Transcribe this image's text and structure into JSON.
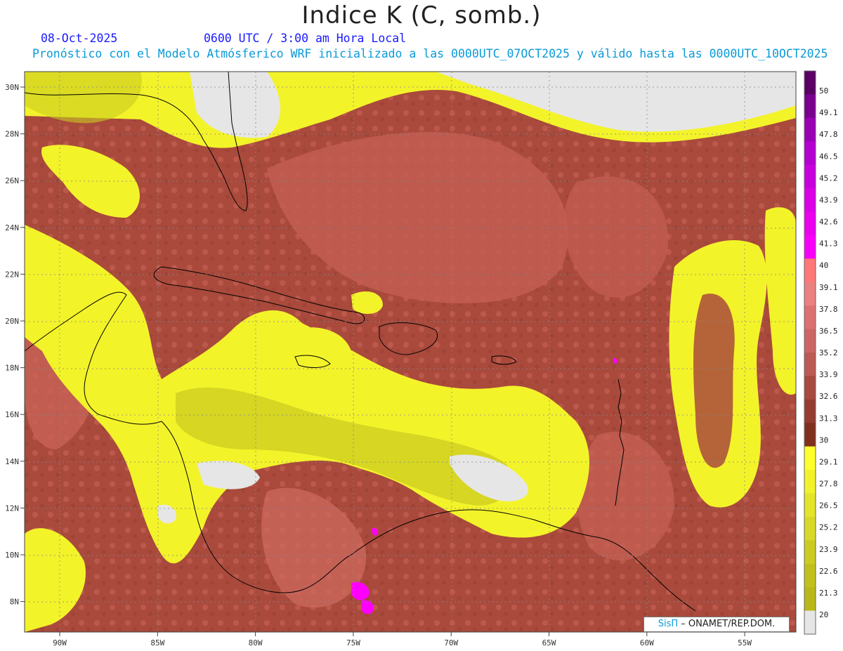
{
  "header": {
    "title": "Indice K (C, somb.)",
    "date": "08-Oct-2025",
    "time": "0600 UTC / 3:00 am Hora Local",
    "forecast": "Pronóstico con el Modelo Atmósferico WRF inicializado a las 0000UTC_07OCT2025 y válido hasta las  0000UTC_10OCT2025"
  },
  "axes": {
    "lon_labels": [
      "90W",
      "85W",
      "80W",
      "75W",
      "70W",
      "65W",
      "60W",
      "55W"
    ],
    "lat_labels": [
      "30N",
      "28N",
      "26N",
      "24N",
      "22N",
      "20N",
      "18N",
      "16N",
      "14N",
      "12N",
      "10N",
      "8N"
    ]
  },
  "colorbar": {
    "labels": [
      "50",
      "49.1",
      "47.8",
      "46.5",
      "45.2",
      "43.9",
      "42.6",
      "41.3",
      "40",
      "39.1",
      "37.8",
      "36.5",
      "35.2",
      "33.9",
      "32.6",
      "31.3",
      "30",
      "29.1",
      "27.8",
      "26.5",
      "25.2",
      "23.9",
      "22.6",
      "21.3",
      "20"
    ],
    "colors": [
      "#5a0064",
      "#7a0090",
      "#9a00b4",
      "#b400d0",
      "#c800dc",
      "#dc00e6",
      "#ec00ee",
      "#fa00fa",
      "#ff7878",
      "#ed8080",
      "#dd7070",
      "#cd6565",
      "#bd5a55",
      "#a84a40",
      "#963c30",
      "#80301c",
      "#ffff2c",
      "#f2f22c",
      "#e4e42a",
      "#d8d828",
      "#cbcb22",
      "#c0c01c",
      "#b8b818",
      "#e6e6e6"
    ]
  },
  "credit": {
    "sis": "SisΠ",
    "org": "– ONAMET/REP.DOM."
  },
  "colors": {
    "land_high": "#9e4434",
    "land_mid": "#c05a50",
    "yellow": "#f3f32a",
    "olive": "#cccc22",
    "gray": "#e6e6e6",
    "magenta": "#ff00ff"
  }
}
